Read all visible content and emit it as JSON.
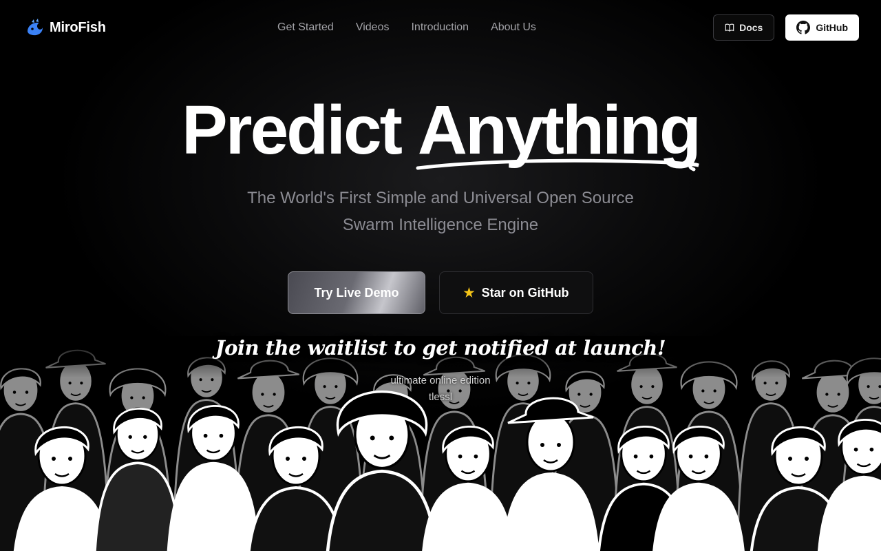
{
  "brand": {
    "name": "MiroFish",
    "logo_icon": "fish-logo-icon",
    "accent": "#3b82f6"
  },
  "nav": {
    "links": [
      "Get Started",
      "Videos",
      "Introduction",
      "About Us"
    ],
    "docs_label": "Docs",
    "docs_icon": "book-icon",
    "github_label": "GitHub",
    "github_icon": "github-icon"
  },
  "hero": {
    "title_word1": "Predict",
    "title_word2": "Anything",
    "subtitle_line1": "The World's First Simple and Universal Open Source",
    "subtitle_line2": "Swarm Intelligence Engine",
    "demo_label": "Try Live Demo",
    "star_label": "Star on GitHub",
    "star_icon": "star-icon",
    "star_color": "#f5c518"
  },
  "waitlist": {
    "heading": "Join the waitlist to get notified at launch!",
    "sub_line1": "ultimate online edition",
    "sub_line2": "tlessl"
  }
}
